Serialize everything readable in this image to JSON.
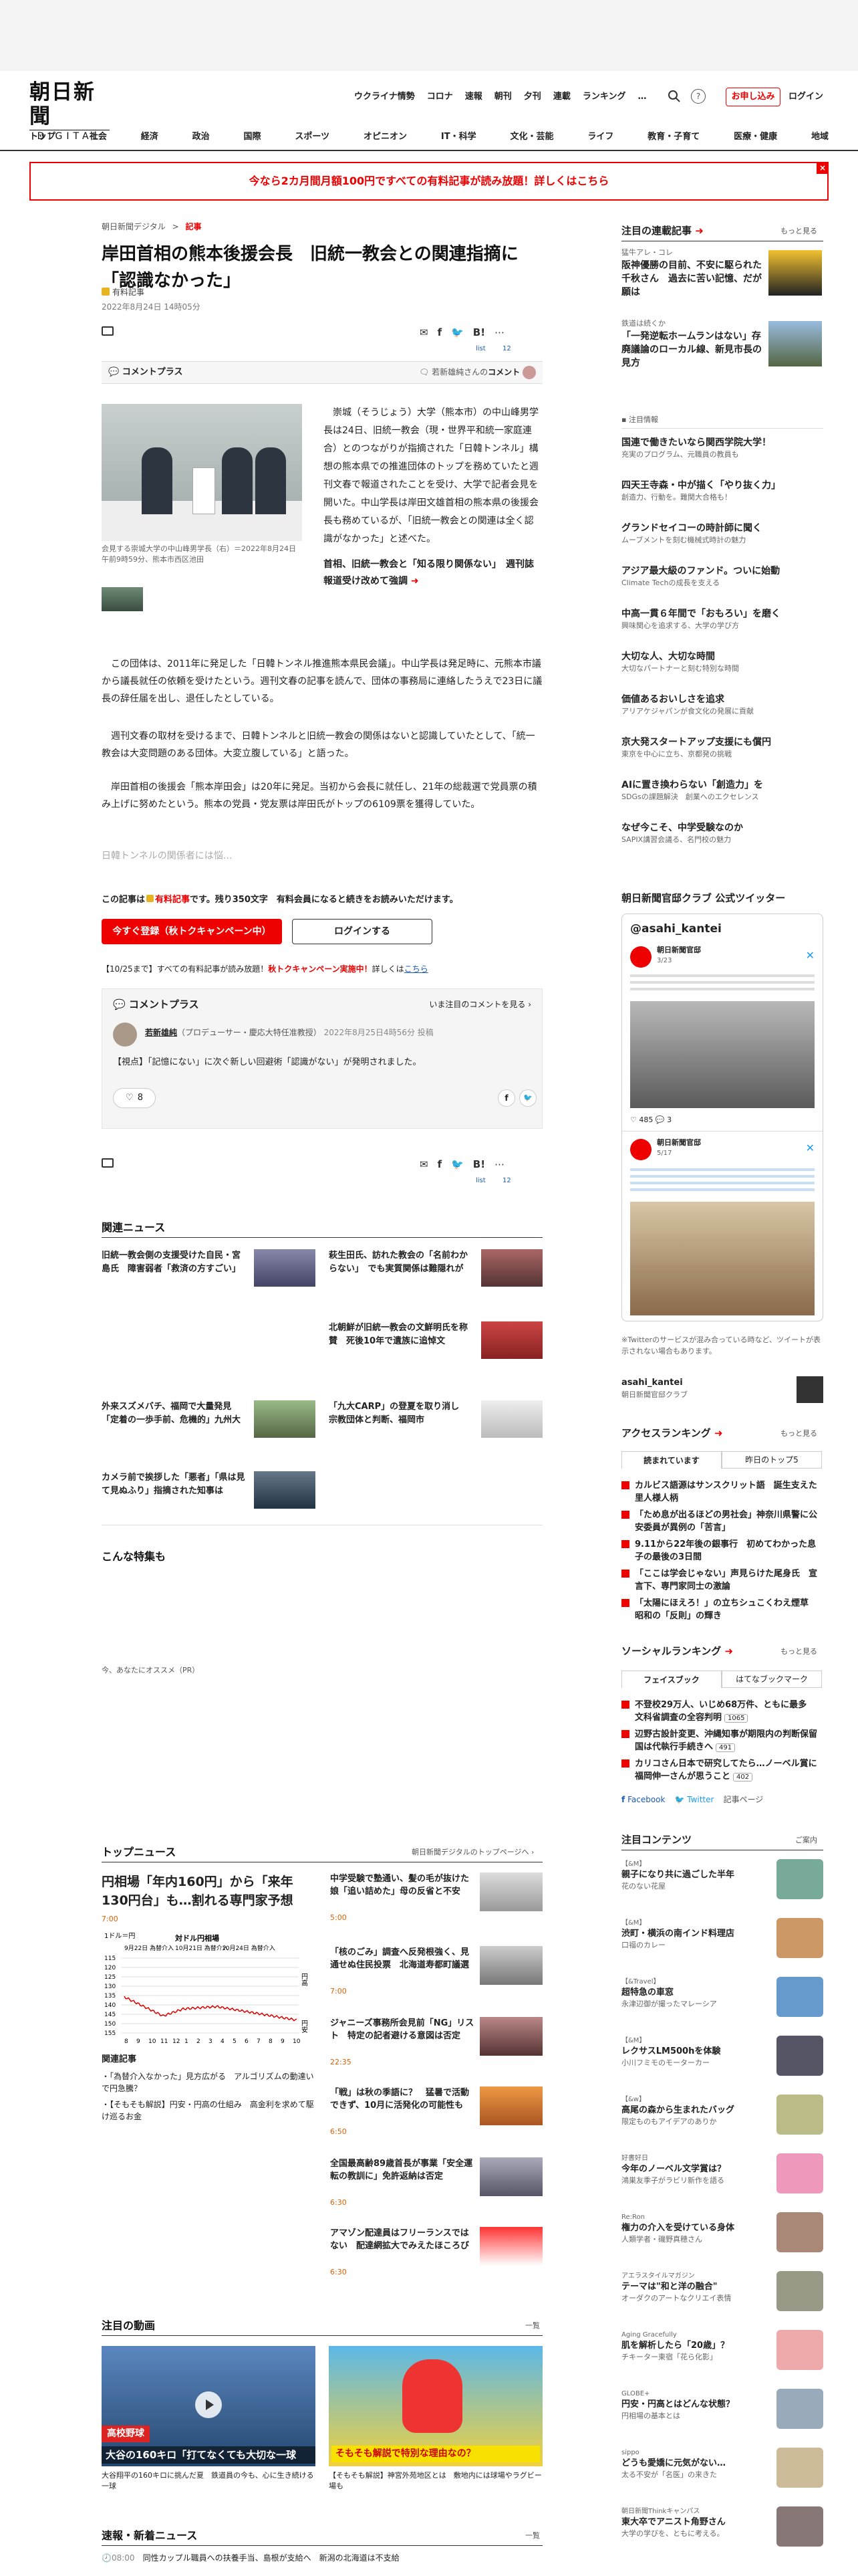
{
  "header": {
    "logo_main": "朝日新聞",
    "logo_sub": "DIGITAL",
    "quick_links": [
      "ウクライナ情勢",
      "コロナ",
      "速報",
      "朝刊",
      "夕刊",
      "連載",
      "ランキング"
    ],
    "more": "…",
    "subscribe": "お申し込み",
    "login": "ログイン"
  },
  "nav": [
    "トップ",
    "社会",
    "経済",
    "政治",
    "国際",
    "スポーツ",
    "オピニオン",
    "IT・科学",
    "文化・芸能",
    "ライフ",
    "教育・子育て",
    "医療・健康",
    "地域"
  ],
  "banner": {
    "text": "今なら2カ月間月額100円ですべての有料記事が読み放題！詳しくはこちら",
    "close": "×"
  },
  "article": {
    "breadcrumb": [
      "朝日新聞デジタル",
      "記事"
    ],
    "title": "岸田首相の熊本後援会長　旧統一教会との関連指摘に「認識なかった」",
    "badge": "有料記事",
    "date": "2022年8月24日 14時05分",
    "share_counts": {
      "list": "list",
      "hatena": "12"
    },
    "comment_plus": "コメントプラス",
    "comment_by": "若新雄純さんの",
    "comment_link": "コメント",
    "photo_caption": "会見する崇城大学の中山峰男学長（右）＝2022年8月24日午前9時59分、熊本市西区池田",
    "lead": "崇城（そうじょう）大学（熊本市）の中山峰男学長は24日、旧統一教会（現・世界平和統一家庭連合）とのつながりが指摘された「日韓トンネル」構想の熊本県での推進団体のトップを務めていたと週刊文春で報道されたことを受け、大学で記者会見を開いた。中山学長は岸田文雄首相の熊本県の後援会長も務めているが、「旧統一教会との関連は全く認識がなかった」と述べた。",
    "related_link": "首相、旧統一教会と「知る限り関係ない」　週刊誌報道受け改めて強調",
    "paras": [
      "この団体は、2011年に発足した「日韓トンネル推進熊本県民会議」。中山学長は発足時に、元熊本市議から議長就任の依頼を受けたという。週刊文春の記事を読んで、団体の事務局に連絡したうえで23日に議長の辞任届を出し、退任したとしている。",
      "週刊文春の取材を受けるまで、日韓トンネルと旧統一教会の関係はないと認識していたとして、「統一教会は大変問題のある団体。大変立腹している」と語った。",
      "岸田首相の後援会「熊本岸田会」は20年に発足。当初から会長に就任し、21年の総裁選で党員票の積み上げに努めたという。熊本の党員・党友票は岸田氏がトップの6109票を獲得していた。"
    ],
    "fade": "日韓トンネルの関係者には悩…",
    "paywall_pre": "この記事は",
    "paywall_badge": "有料記事",
    "paywall_post": "です。残り350文字　有料会員になると続きをお読みいただけます。",
    "cta_register": "今すぐ登録（秋トクキャンペーン中）",
    "cta_login": "ログインする",
    "campaign_pre": "【10/25まで】すべての有料記事が読み放題！",
    "campaign_red": "秋トクキャンペーン実施中！",
    "campaign_post": "詳しくは",
    "campaign_link": "こちら"
  },
  "comment_box": {
    "title": "コメントプラス",
    "view_all": "いま注目のコメントを見る",
    "name": "若新雄純",
    "role": "（プロデューサー・慶応大特任准教授）",
    "date": "2022年8月25日4時56分 投稿",
    "text": "【視点】「記憶にない」に次ぐ新しい回避術「認識がない」が発明されました。",
    "likes": "8"
  },
  "related_news": {
    "title": "関連ニュース",
    "items": [
      "旧統一教会側の支援受けた自民・宮島氏　障害弱者「救済の方すごい」",
      "萩生田氏、訪れた教会の「名前わからない」　でも実質関係は難隠れが",
      "北朝鮮が旧統一教会の文鮮明氏を称賛　死後10年で遺族に追悼文",
      "外来スズメバチ、福岡で大量発見　「定着の一歩手前、危機的」九州大",
      "「九大CARP」の登夏を取り消し　宗教団体と判断、福岡市",
      "カメラ前で挨拶した「悪者」「県は見て見ぬふり」指摘された知事は"
    ]
  },
  "feature": {
    "title": "こんな特集も",
    "pr": "今、あなたにオススメ（PR）"
  },
  "top_news": {
    "title": "トップニュース",
    "link": "朝日新聞デジタルのトップページへ",
    "main_title": "円相場「年内160円」から「来年130円台」も…割れる専門家予想",
    "main_time": "7:00",
    "chart_ylabel": "1ドル＝円",
    "chart_right_label": "円高",
    "chart_right_label2": "円安",
    "chart_annot1": "9月22日 為替介入",
    "chart_annot2": "10月21日 為替介入",
    "chart_annot3": "10月24日 為替介入",
    "chart_title": "対ドル円相場",
    "related_head": "関連記事",
    "related": [
      "「為替介入なかった」見方広がる　アルゴリズムの動達いで円急騰？",
      "【そもそも解説】円安・円高の仕組み　高金利を求めて駆け巡るお金"
    ],
    "items": [
      {
        "h": "中学受験で塾通い、髪の毛が抜けた娘「追い詰めた」母の反省と不安",
        "t": "5:00"
      },
      {
        "h": "「核のごみ」調査へ反発根強く、見通せぬ住民投票　北海道寿都町議選",
        "t": "7:00"
      },
      {
        "h": "ジャニーズ事務所会見前「NG」リスト　特定の記者避ける意図は否定",
        "t": "22:35"
      },
      {
        "h": "「戦」は秋の季語に？　猛暑で活動できず、10月に活発化の可能性も",
        "t": "6:50"
      },
      {
        "h": "全国最高齢89歳首長が事業「安全運転の教訓に」免許返納は否定",
        "t": "6:30"
      },
      {
        "h": "アマゾン配達員はフリーランスではない　配達網拡大でみえたほころび",
        "t": "6:30"
      }
    ]
  },
  "videos": {
    "title": "注目の動画",
    "more": "一覧",
    "items": [
      {
        "overlay1": "高校野球",
        "overlay2": "大谷の160キロ「打てなくても大切な一球",
        "cap": "大谷翔平の160キロに挑んだ夏　鉄道員の今も、心に生き続ける一球"
      },
      {
        "overlay1": "そもそも解説で特別な理由なの？",
        "cap": "【そもそも解説】神宮外苑地区とは　敷地内には球場やラグビー場も"
      }
    ]
  },
  "breaking": {
    "title": "速報・新着ニュース",
    "more": "一覧",
    "time": "08:00",
    "text": "同性カップル職員への扶養手当、島根が支給へ　新潟の北海道は不支給"
  },
  "sidebar": {
    "series_title": "注目の連載記事",
    "more": "もっと見る",
    "series": [
      {
        "lb": "猛牛アレ・コレ",
        "h": "阪神優勝の目前、不安に駆られた千秋さん　過去に苦い記憶、だが願は",
        "s": ""
      },
      {
        "lb": "鉄道は続くか",
        "h": "「一発逆転ホームランはない」存廃議論のローカル線、新見市長の見方",
        "s": ""
      }
    ],
    "pr_label": "注目情報",
    "pr_items": [
      {
        "h": "国連で働きたいなら関西学院大学！",
        "s": "充実のプログラム、元職員の教員も"
      },
      {
        "h": "四天王寺森・中が描く「やり抜く力」",
        "s": "創造力、行動を。難関大合格も！"
      },
      {
        "h": "グランドセイコーの時計師に聞く",
        "s": "ムーブメントを刻む機械式時計の魅力"
      },
      {
        "h": "アジア最大級のファンド。ついに始動",
        "s": "Climate Techの成長を支える"
      },
      {
        "h": "中高一貫６年間で「おもろい」を磨く",
        "s": "興味関心を追求する、大学の学び方"
      },
      {
        "h": "大切な人、大切な時間",
        "s": "大切なパートナーと刻む特別な時間"
      },
      {
        "h": "価値あるおいしさを追求",
        "s": "アリアケジャパンが食文化の発展に貢献"
      },
      {
        "h": "京大発スタートアップ支援にも償円",
        "s": "東京を中心に立ち、京都発の挑戦"
      },
      {
        "h": "AIに置き換わらない「創造力」を",
        "s": "SDGsの課題解決　創業へのエクセレンス"
      },
      {
        "h": "なぜ今こそ、中学受験なのか",
        "s": "SAPIX講習会議る、名門校の魅力"
      }
    ],
    "twitter_title": "朝日新聞官邸クラブ 公式ツイッター",
    "tw_handle": "@asahi_kantei",
    "tw_name": "朝日新聞官邸",
    "tw_time": "3/23",
    "tw_time2": "5/17",
    "tw_count1": "485",
    "tw_count2": "3",
    "tw_note": "※Twitterのサービスが混み合っている時など、ツイートが表示されない場合もあります。",
    "tw_account": "asahi_kantei",
    "tw_account_sub": "朝日新聞官邸クラブ",
    "access_title": "アクセスランキング",
    "access_tabs": [
      "読まれています",
      "昨日のトップ5"
    ],
    "access": [
      "カルビス語源はサンスクリット語　誕生支えた里人様人柄",
      "「ため息が出るほどの男社会」神奈川県警に公安委員が異例の「苦言」",
      "9.11から22年後の銀事行　初めてわかった息子の最後の3日間",
      "「ここは学会じゃない」声見らけた尾身氏　宣言下、専門家同士の激論",
      "「太陽にほえろ！」の立ちシュこくわえ煙草　昭和の「反則」の輝き"
    ],
    "social_title": "ソーシャルランキング",
    "social_tabs": [
      "フェイスブック",
      "はてなブックマーク"
    ],
    "social": [
      {
        "h": "不登校29万人、いじめ68万件、ともに最多　文科省調査の全容判明",
        "c": "1065"
      },
      {
        "h": "辺野古設計変更、沖縄知事が期限内の判断保留　国は代執行手続きへ",
        "c": "491"
      },
      {
        "h": "カリコさん日本で研究してたら…ノーベル賞に福岡伸一さんが思うこと",
        "c": "402"
      }
    ],
    "fb": "Facebook",
    "tw": "Twitter",
    "social_more": "記事ページ",
    "contents_title": "注目コンテンツ",
    "contents_more": "ご案内",
    "contents": [
      {
        "lb": "【&M】",
        "h": "親子になり共に過ごした半年",
        "s": "花のない花屋"
      },
      {
        "lb": "【&M】",
        "h": "渋町・横浜の南インド料理店",
        "s": "口福のカレー"
      },
      {
        "lb": "【&Travel】",
        "h": "超特急の車窓",
        "s": "永津辺御が撮ったマレーシア"
      },
      {
        "lb": "【&M】",
        "h": "レクサスLM500hを体験",
        "s": "小川フミモのモーターカー"
      },
      {
        "lb": "【&w】",
        "h": "高尾の森から生まれたバッグ",
        "s": "限定ものもアイデアのありか"
      },
      {
        "lb": "好書好日",
        "h": "今年のノーベル文学賞は？",
        "s": "鴻巣友季子がラビリ新作を語る"
      },
      {
        "lb": "Re:Ron",
        "h": "権力の介入を受けている身体",
        "s": "人類学者・磯野真穂さん"
      },
      {
        "lb": "アエラスタイルマガジン",
        "h": "テーマは\"和と洋の融合\"",
        "s": "オーダクのアートなクリエイ表情"
      },
      {
        "lb": "Aging Gracefully",
        "h": "肌を解析したら「20歳」？",
        "s": "チキーター東宿「花ら化影」"
      },
      {
        "lb": "GLOBE+",
        "h": "円安・円高とはどんな状態？",
        "s": "円相場の基本とは"
      },
      {
        "lb": "sippo",
        "h": "どうも愛嬌に元気がない…",
        "s": "太る不安が「名医」の来きた"
      },
      {
        "lb": "朝日新聞Thinkキャンパス",
        "h": "東大卒でアニスト角野さん",
        "s": "大学の学びを、ともに考える。"
      }
    ]
  },
  "colors": {
    "accent": "#e00000",
    "link": "#1a5ab8",
    "bg": "#ffffff"
  }
}
